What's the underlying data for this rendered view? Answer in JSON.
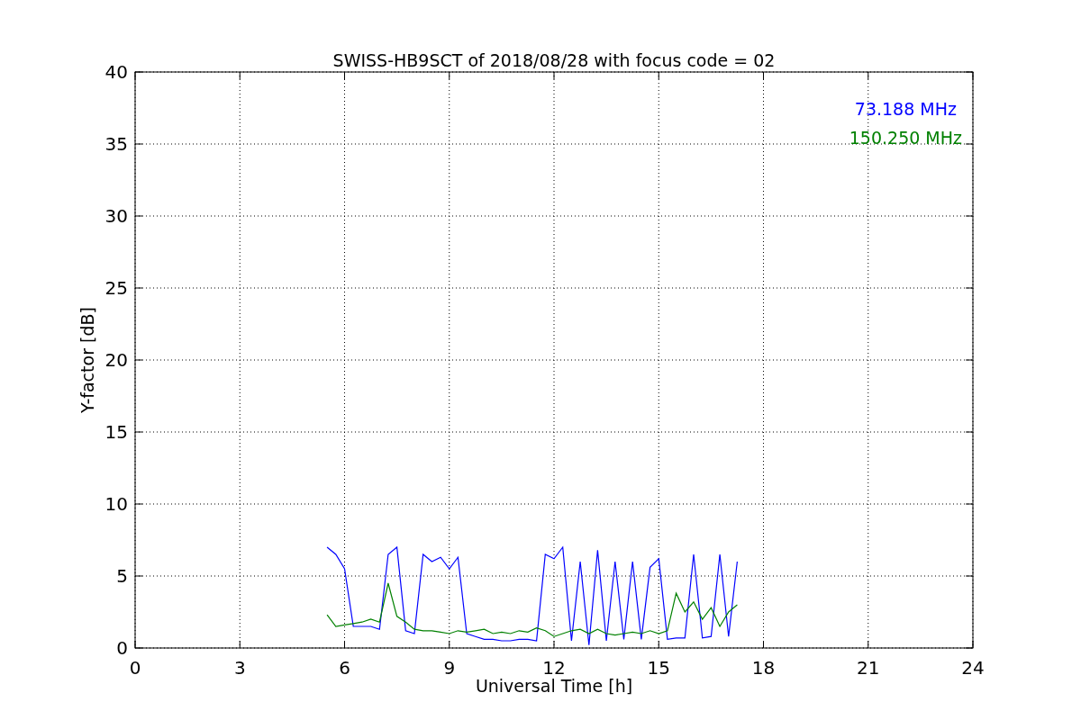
{
  "chart_data": {
    "type": "line",
    "title": "SWISS-HB9SCT of 2018/08/28 with focus code = 02",
    "xlabel": "Universal Time [h]",
    "ylabel": "Y-factor [dB]",
    "x": [
      5.5,
      5.75,
      6.0,
      6.25,
      6.5,
      6.75,
      7.0,
      7.25,
      7.5,
      7.75,
      8.0,
      8.25,
      8.5,
      8.75,
      9.0,
      9.25,
      9.5,
      9.75,
      10.0,
      10.25,
      10.5,
      10.75,
      11.0,
      11.25,
      11.5,
      11.75,
      12.0,
      12.25,
      12.5,
      12.75,
      13.0,
      13.25,
      13.5,
      13.75,
      14.0,
      14.25,
      14.5,
      14.75,
      15.0,
      15.25,
      15.5,
      15.75,
      16.0,
      16.25,
      16.5,
      16.75,
      17.0,
      17.25
    ],
    "series": [
      {
        "name": "73.188 MHz",
        "color": "#0000ff",
        "values": [
          7.0,
          6.5,
          5.5,
          1.5,
          1.5,
          1.5,
          1.3,
          6.5,
          7.0,
          1.2,
          1.0,
          6.5,
          6.0,
          6.3,
          5.5,
          6.3,
          1.0,
          0.8,
          0.6,
          0.6,
          0.5,
          0.5,
          0.6,
          0.6,
          0.5,
          6.5,
          6.2,
          7.0,
          0.5,
          6.0,
          0.2,
          6.8,
          0.5,
          6.0,
          0.6,
          6.0,
          0.6,
          5.6,
          6.2,
          0.6,
          0.7,
          0.7,
          6.5,
          0.7,
          0.8,
          6.5,
          0.8,
          6.0
        ]
      },
      {
        "name": "150.250 MHz",
        "color": "#008000",
        "values": [
          2.3,
          1.5,
          1.6,
          1.7,
          1.8,
          2.0,
          1.8,
          4.5,
          2.2,
          1.8,
          1.3,
          1.2,
          1.2,
          1.1,
          1.0,
          1.2,
          1.1,
          1.2,
          1.3,
          1.0,
          1.1,
          1.0,
          1.2,
          1.1,
          1.4,
          1.2,
          0.8,
          1.0,
          1.2,
          1.3,
          1.0,
          1.3,
          1.0,
          0.9,
          1.0,
          1.1,
          1.0,
          1.2,
          1.0,
          1.2,
          3.8,
          2.5,
          3.2,
          2.0,
          2.8,
          1.5,
          2.5,
          3.0
        ]
      }
    ],
    "xlim": [
      0,
      24
    ],
    "ylim": [
      0,
      40
    ],
    "xticks": [
      0,
      3,
      6,
      9,
      12,
      15,
      18,
      21,
      24
    ],
    "yticks": [
      0,
      5,
      10,
      15,
      20,
      25,
      30,
      35,
      40
    ],
    "grid": true
  }
}
